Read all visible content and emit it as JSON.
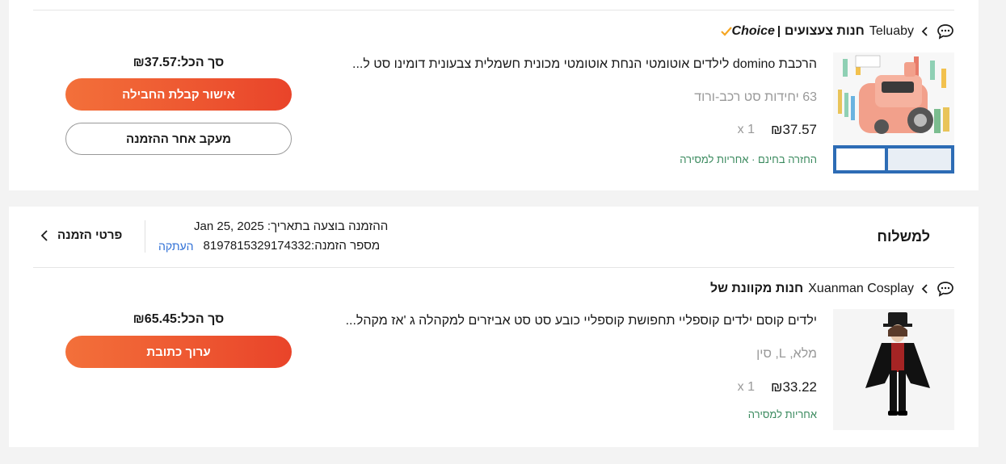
{
  "order1": {
    "store": {
      "badge": "Choice",
      "prefix": "חנות צעצועים",
      "name": "Teluaby"
    },
    "product": {
      "title": "הרכבת domino לילדים אוטומטי הנחת אוטומטי מכונית חשמלית צבעונית דומינו סט ל...",
      "sku": "63 יחידות סט רכב-ורוד",
      "price": "₪37.57",
      "qty": "x 1",
      "tags": "החזרה בחינם · אחריות למסירה",
      "image_caption": "63pcs Car Set Pink"
    },
    "total": "סך הכל:₪37.57",
    "confirm_button": "אישור קבלת החבילה",
    "track_button": "מעקב אחר ההזמנה"
  },
  "order2": {
    "status": "למשלוח",
    "date_line": "ההזמנה בוצעה בתאריך: Jan 25, 2025",
    "order_number": "מספר הזמנה:8197815329174332",
    "copy_label": "העתקה",
    "details_label": "פרטי הזמנה",
    "store": {
      "prefix": "חנות מקוונת של",
      "name": "Xuanman Cosplay"
    },
    "product": {
      "title": "ילדים קוסם ילדים קוספליי תחפושת קוספליי כובע סט סט אביזרים למקהלה ג 'אז מקהל...",
      "sku": "מלא, L, סין",
      "price": "₪33.22",
      "qty": "x 1",
      "tags": "אחריות למסירה"
    },
    "total": "סך הכל:₪65.45",
    "edit_button": "ערוך כתובת"
  },
  "colors": {
    "accent_start": "#f3703a",
    "accent_end": "#e9442a",
    "tag_green": "#3a8a5e",
    "link_blue": "#2e6fd6"
  }
}
